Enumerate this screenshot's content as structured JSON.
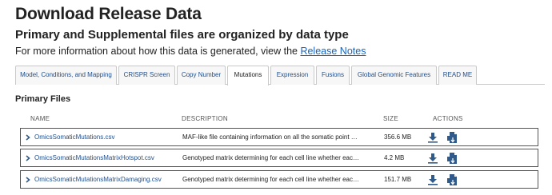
{
  "page": {
    "title": "Download Release Data",
    "subtitle": "Primary and Supplemental files are organized by data type",
    "info_text": "For more information about how this data is generated, view the ",
    "info_link": "Release Notes"
  },
  "tabs": [
    {
      "label": "Model, Conditions, and Mapping",
      "active": false
    },
    {
      "label": "CRISPR Screen",
      "active": false
    },
    {
      "label": "Copy Number",
      "active": false
    },
    {
      "label": "Mutations",
      "active": true
    },
    {
      "label": "Expression",
      "active": false
    },
    {
      "label": "Fusions",
      "active": false
    },
    {
      "label": "Global Genomic Features",
      "active": false
    },
    {
      "label": "READ ME",
      "active": false
    }
  ],
  "section": {
    "title": "Primary Files"
  },
  "table": {
    "columns": {
      "name": "NAME",
      "description": "DESCRIPTION",
      "size": "SIZE",
      "actions": "ACTIONS"
    },
    "rows": [
      {
        "name": "OmicsSomaticMutations.csv",
        "description": "MAF-like file containing information on all the somatic point mutatio...",
        "size": "356.6 MB"
      },
      {
        "name": "OmicsSomaticMutationsMatrixHotspot.csv",
        "description": "Genotyped matrix determining for each cell line whether each gene ...",
        "size": "4.2 MB"
      },
      {
        "name": "OmicsSomaticMutationsMatrixDamaging.csv",
        "description": "Genotyped matrix determining for each cell line whether each gene ...",
        "size": "151.7 MB"
      }
    ]
  },
  "colors": {
    "link": "#1565c0",
    "tab_text": "#1f4e8c",
    "icon": "#2f5a8a"
  },
  "icons": {
    "expand": "chevron-right-icon",
    "download": "download-icon",
    "download_alt": "file-download-icon"
  }
}
